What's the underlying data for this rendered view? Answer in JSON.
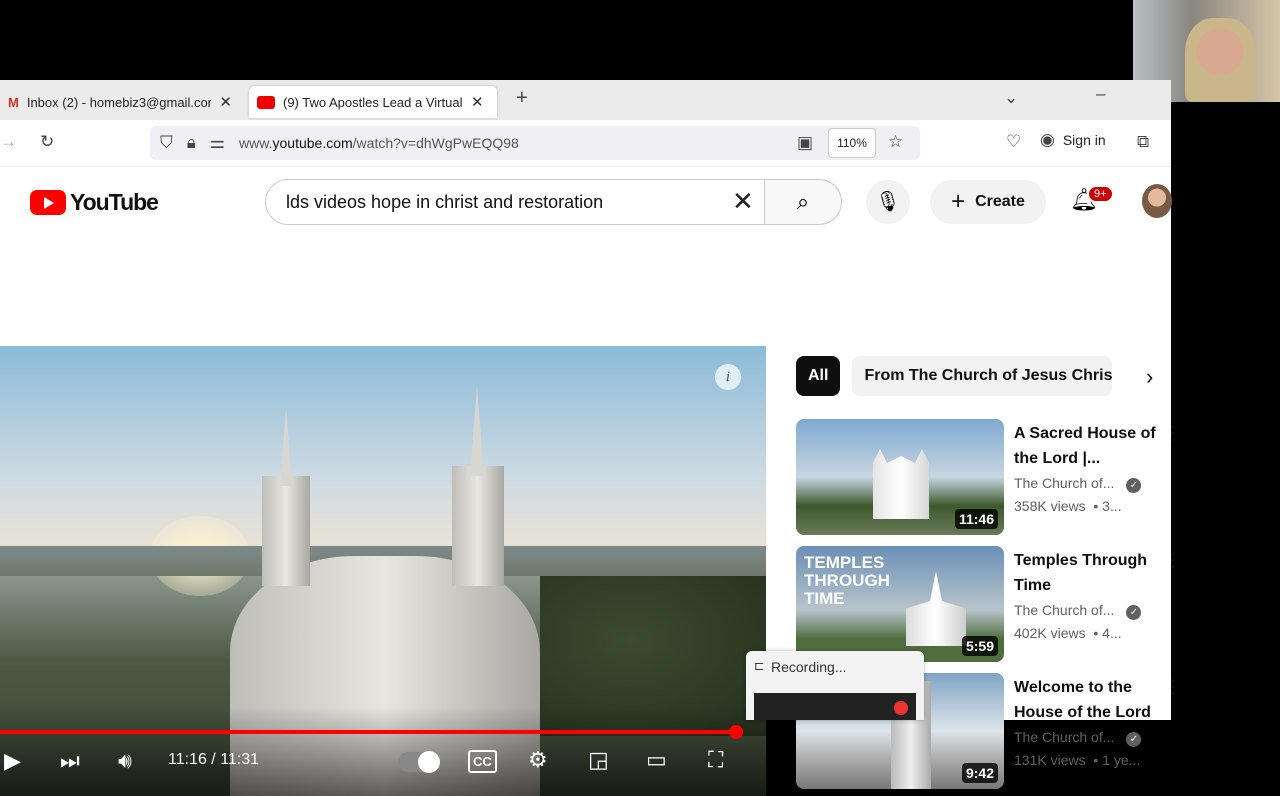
{
  "tabs": [
    {
      "label": "Inbox (2) - homebiz3@gmail.con",
      "icon": "gmail-icon"
    },
    {
      "label": "(9) Two Apostles Lead a Virtual To",
      "icon": "youtube-icon"
    }
  ],
  "address": {
    "prefix": "www.",
    "domain": "youtube.com",
    "path": "/watch?v=dhWgPwEQQ98",
    "zoom": "110%",
    "sign_in": "Sign in"
  },
  "youtube": {
    "logo": "YouTube",
    "search_value": "lds videos hope in christ and restoration",
    "create": "Create",
    "notifications": "9+"
  },
  "player": {
    "time": "11:16 / 11:31",
    "progress": 0.98,
    "cc": "CC"
  },
  "chips": [
    "All",
    "From The Church of Jesus Chris"
  ],
  "recommendations": [
    {
      "title": "A Sacred House of the Lord |...",
      "channel": "The Church of...",
      "views": "358K views",
      "age": "• 3...",
      "duration": "11:46"
    },
    {
      "title": "Temples Through Time",
      "channel": "The Church of...",
      "views": "402K views",
      "age": "• 4...",
      "duration": "5:59",
      "thumb_text": "TEMPLES THROUGH TIME"
    },
    {
      "title": "Welcome to the House of the Lord",
      "channel": "The Church of...",
      "views": "131K views",
      "age": "• 1 ye...",
      "duration": "9:42"
    }
  ],
  "recording": {
    "label": "Recording..."
  }
}
